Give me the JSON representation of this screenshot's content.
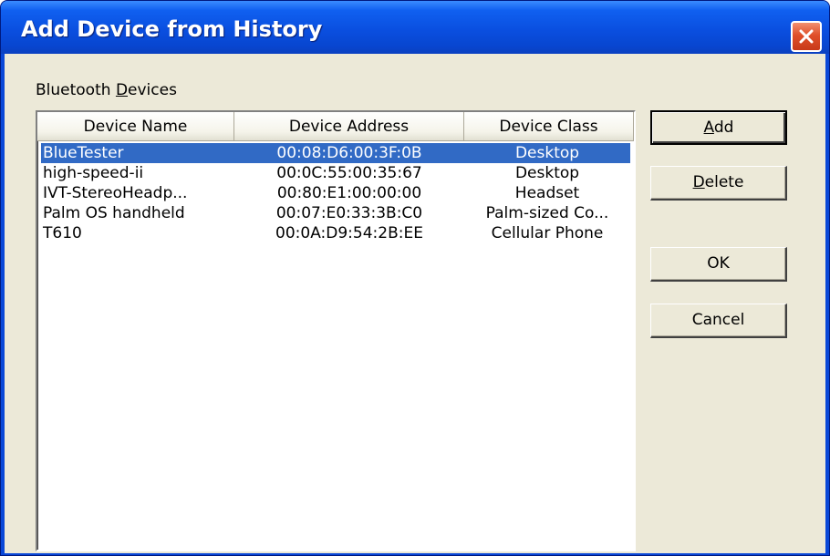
{
  "window": {
    "title": "Add Device from History"
  },
  "group": {
    "label_before": "Bluetooth ",
    "label_mnemonic": "D",
    "label_after": "evices"
  },
  "columns": {
    "name": "Device Name",
    "address": "Device Address",
    "class": "Device Class"
  },
  "devices": [
    {
      "name": "BlueTester",
      "address": "00:08:D6:00:3F:0B",
      "class": "Desktop",
      "selected": true
    },
    {
      "name": "high-speed-ii",
      "address": "00:0C:55:00:35:67",
      "class": "Desktop",
      "selected": false
    },
    {
      "name": "IVT-StereoHeadp...",
      "address": "00:80:E1:00:00:00",
      "class": "Headset",
      "selected": false
    },
    {
      "name": "Palm OS handheld",
      "address": "00:07:E0:33:3B:C0",
      "class": "Palm-sized Co...",
      "selected": false
    },
    {
      "name": "T610",
      "address": "00:0A:D9:54:2B:EE",
      "class": "Cellular Phone",
      "selected": false
    }
  ],
  "buttons": {
    "add_mnemonic": "A",
    "add_rest": "dd",
    "delete_mnemonic": "D",
    "delete_rest": "elete",
    "ok": "OK",
    "cancel": "Cancel"
  },
  "colors": {
    "titlebar": "#0a4fe0",
    "selection": "#316ac5",
    "dialog_face": "#ece9d8",
    "close_button": "#e0502a"
  },
  "icons": {
    "close": "close-x-icon"
  }
}
